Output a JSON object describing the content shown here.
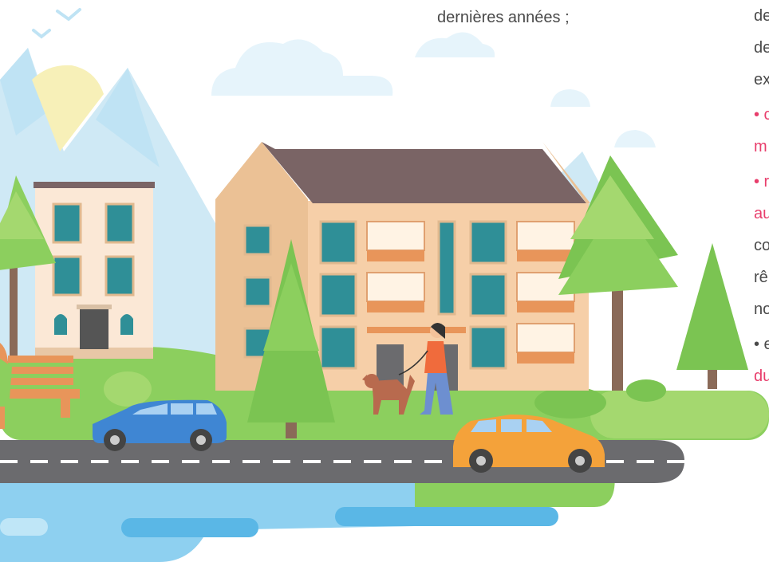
{
  "caption": {
    "center_line": "dernières années ;"
  },
  "right_column": {
    "lines": [
      {
        "text": "de",
        "color": "default"
      },
      {
        "text": "de",
        "color": "default"
      },
      {
        "text": "ex",
        "color": "default"
      },
      {
        "text": "• c",
        "color": "pink"
      },
      {
        "text": "m",
        "color": "pink"
      },
      {
        "text": "• r",
        "color": "pink"
      },
      {
        "text": "au",
        "color": "pink"
      },
      {
        "text": "co",
        "color": "default"
      },
      {
        "text": "rê",
        "color": "default"
      },
      {
        "text": "no",
        "color": "default"
      },
      {
        "text": "• e",
        "color": "default"
      },
      {
        "text": "du",
        "color": "pink"
      }
    ]
  },
  "colors": {
    "accent_pink": "#e83e6c",
    "text_grey": "#4a4a4a",
    "sky_mountain": "#cfe9f5",
    "grass": "#8ccf5e",
    "road": "#6b6b6e",
    "water": "#8ed0f0",
    "building_main": "#f6cfa8",
    "roof": "#7a6465",
    "window": "#2f8f97",
    "car_blue": "#3f86d3",
    "car_orange": "#f4a23a"
  }
}
